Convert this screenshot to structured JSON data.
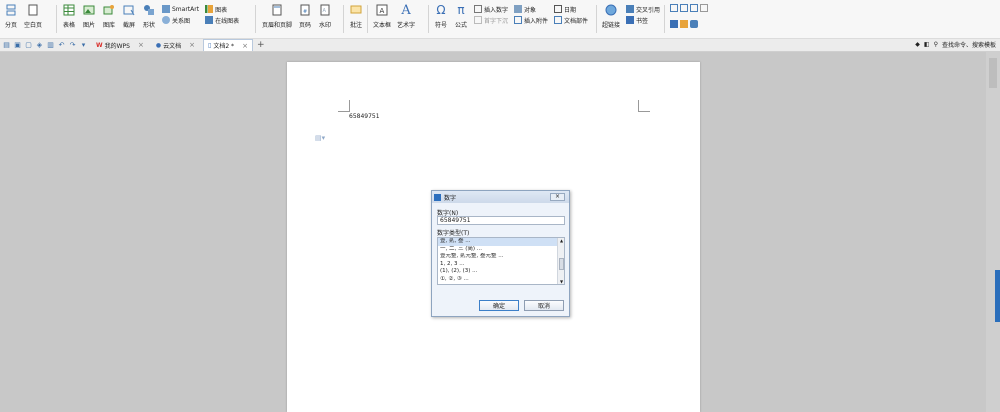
{
  "ribbon": {
    "group1": [
      {
        "label": "分页"
      },
      {
        "label": "空白页"
      }
    ],
    "group2": [
      {
        "label": "表格"
      },
      {
        "label": "图片"
      },
      {
        "label": "图库"
      },
      {
        "label": "截屏"
      },
      {
        "label": "形状"
      }
    ],
    "group2_small": [
      {
        "label": "SmartArt"
      },
      {
        "label": "关系图"
      },
      {
        "label": "图表"
      },
      {
        "label": "在线图表"
      }
    ],
    "group3": [
      {
        "label": "页眉和页脚"
      },
      {
        "label": "页码"
      },
      {
        "label": "水印"
      }
    ],
    "group4": [
      {
        "label": "批注"
      }
    ],
    "group5": [
      {
        "label": "文本框"
      },
      {
        "label": "艺术字"
      }
    ],
    "group6": [
      {
        "label": "符号"
      },
      {
        "label": "公式"
      }
    ],
    "group6_small": [
      {
        "label": "插入数字"
      },
      {
        "label": "首字下沉"
      },
      {
        "label": "对象"
      },
      {
        "label": "插入附件"
      },
      {
        "label": "日期"
      },
      {
        "label": "文档部件"
      }
    ],
    "group7": [
      {
        "label": "超链接"
      }
    ],
    "group7_small": [
      {
        "label": "交叉引用"
      },
      {
        "label": "书签"
      }
    ]
  },
  "tabs": [
    {
      "label": "我的WPS"
    },
    {
      "label": "云文档"
    },
    {
      "label": "文档2 *"
    }
  ],
  "right_tools": {
    "search_label": "查找命令、搜索模板"
  },
  "document": {
    "text": "65849751"
  },
  "dialog": {
    "title": "数字",
    "close": "×",
    "number_label": "数字(N)",
    "number_value": "65849751",
    "type_label": "数字类型(T)",
    "types": [
      "壹, 贰, 叁 ...",
      "一, 二, 三 (简) ...",
      "壹元整, 贰元整, 叁元整 ...",
      "1, 2, 3 ...",
      "(1), (2), (3) ...",
      "①, ②, ③ ..."
    ],
    "ok": "确定",
    "cancel": "取消"
  },
  "colors": {
    "accent": "#2a6ebb",
    "dialog_bg": "#eef3fa",
    "page": "#ffffff",
    "canvas": "#c8c8c8"
  }
}
